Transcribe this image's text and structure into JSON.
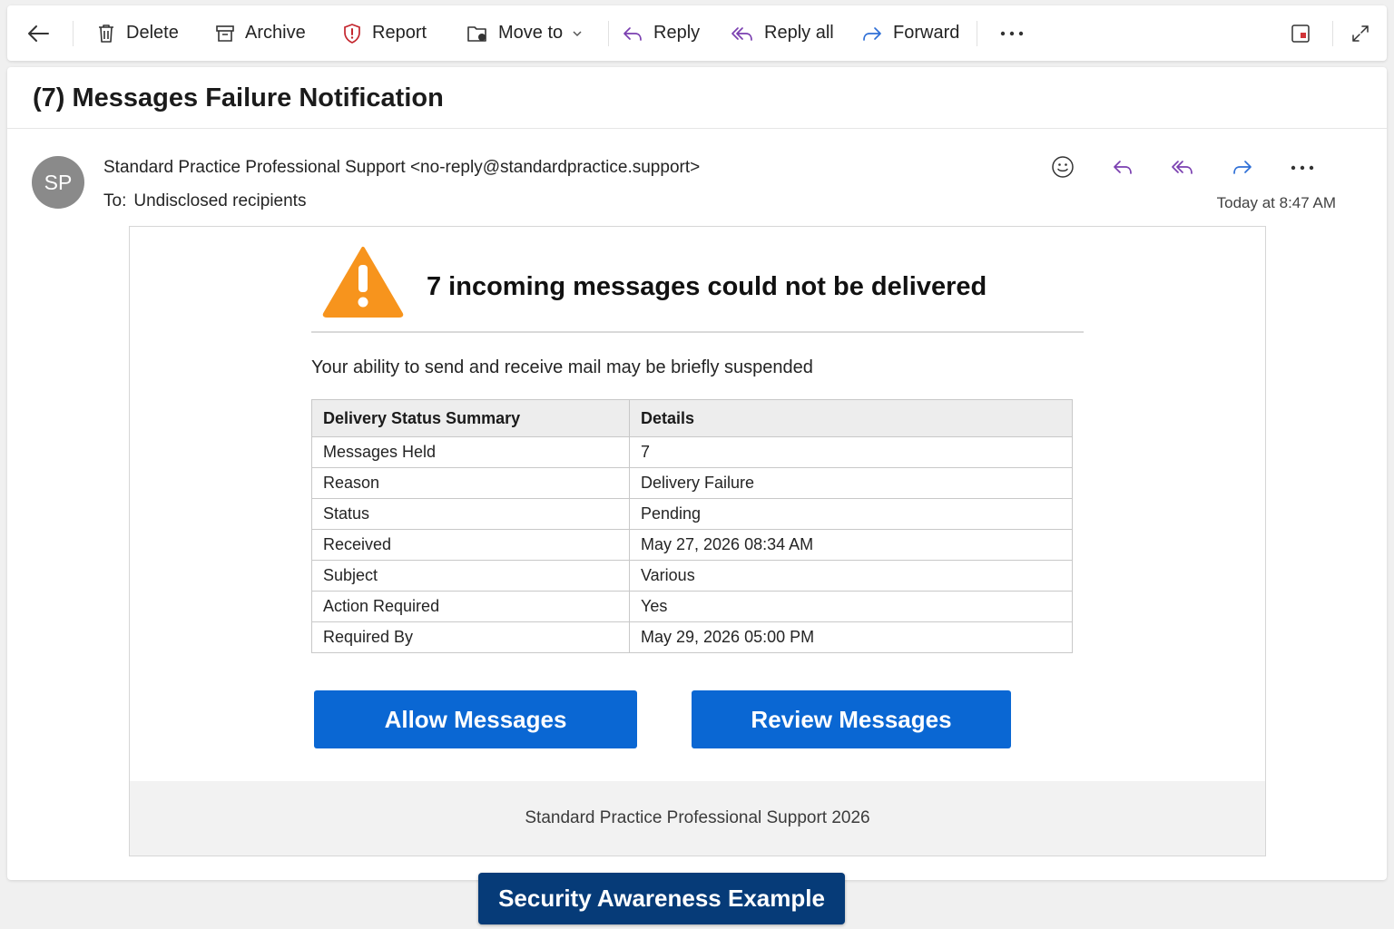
{
  "toolbar": {
    "back_icon": "back-arrow-icon",
    "delete_label": "Delete",
    "archive_label": "Archive",
    "report_label": "Report",
    "move_label": "Move to",
    "reply_label": "Reply",
    "reply_all_label": "Reply all",
    "forward_label": "Forward",
    "more_icon": "more-icon",
    "side_panel_icon": "side-panel-icon",
    "expand_icon": "expand-icon"
  },
  "email": {
    "subject": "(7) Messages Failure Notification",
    "sender_initials": "SP",
    "sender": "Standard Practice Professional Support <no-reply@standardpractice.support>",
    "to_prefix": "To:",
    "to": "Undisclosed recipients",
    "timestamp": "Today at 8:47 AM"
  },
  "body": {
    "headline": "7 incoming messages could not be delivered",
    "intro": "Your ability to send and receive mail may be briefly suspended",
    "table": {
      "headers": [
        "Delivery Status Summary",
        "Details"
      ],
      "rows": [
        [
          "Messages Held",
          "7"
        ],
        [
          "Reason",
          "Delivery Failure"
        ],
        [
          "Status",
          "Pending"
        ],
        [
          "Received",
          "May 27, 2026 08:34 AM"
        ],
        [
          "Subject",
          "Various"
        ],
        [
          "Action Required",
          "Yes"
        ],
        [
          "Required By",
          "May 29, 2026 05:00 PM"
        ]
      ]
    },
    "allow_button": "Allow Messages",
    "review_button": "Review Messages",
    "footer": "Standard Practice Professional Support 2026"
  },
  "banner": "Security Awareness Example",
  "colors": {
    "accent": "#0a67d3",
    "banner": "#063b78",
    "warning": "#f7941d",
    "reply_purple": "#7a3fb0",
    "forward_blue": "#2f6fd6",
    "report_red": "#c4262e"
  }
}
